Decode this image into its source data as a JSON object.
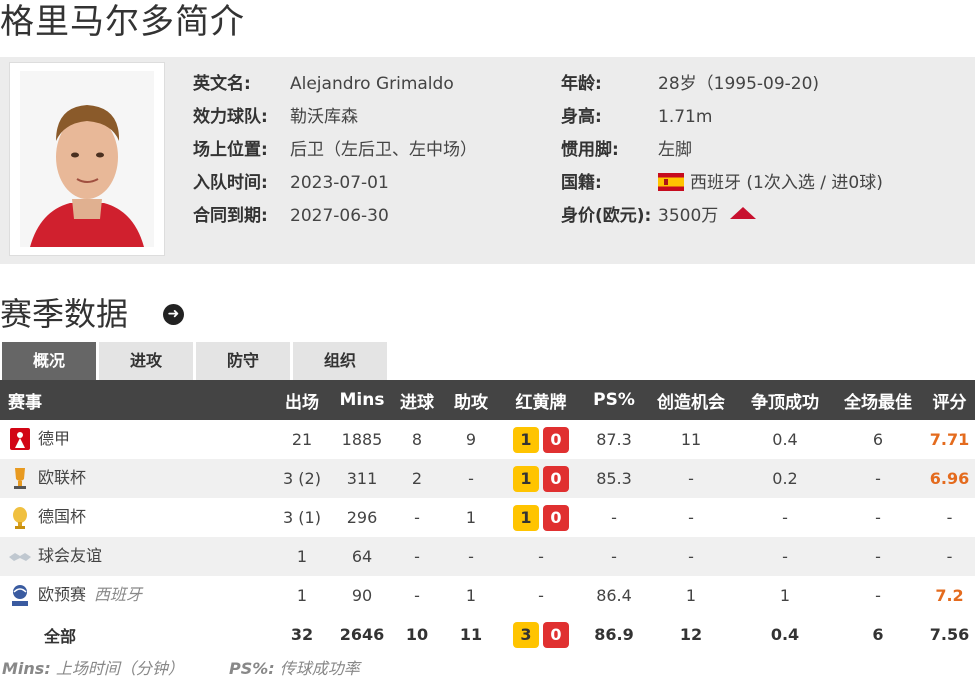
{
  "page_title": "格里马尔多简介",
  "profile": {
    "left": [
      {
        "label": "英文名:",
        "value": "Alejandro Grimaldo"
      },
      {
        "label": "效力球队:",
        "value": "勒沃库森"
      },
      {
        "label": "场上位置:",
        "value": "后卫（左后卫、左中场）"
      },
      {
        "label": "入队时间:",
        "value": "2023-07-01"
      },
      {
        "label": "合同到期:",
        "value": "2027-06-30"
      }
    ],
    "right": [
      {
        "label": "年龄:",
        "value": "28岁（1995-09-20)"
      },
      {
        "label": "身高:",
        "value": "1.71m"
      },
      {
        "label": "惯用脚:",
        "value": "左脚"
      },
      {
        "label": "国籍:",
        "value": "西班牙 (1次入选 / 进0球)"
      },
      {
        "label": "身价(欧元):",
        "value": "3500万"
      }
    ]
  },
  "section_title": "赛季数据",
  "tabs": [
    "概况",
    "进攻",
    "防守",
    "组织"
  ],
  "table": {
    "headers": [
      "赛事",
      "出场",
      "Mins",
      "进球",
      "助攻",
      "红黄牌",
      "PS%",
      "创造机会",
      "争顶成功",
      "全场最佳",
      "评分"
    ],
    "rows": [
      {
        "icon": "bundesliga-icon",
        "comp": "德甲",
        "sub": "",
        "apps": "21",
        "mins": "1885",
        "goals": "8",
        "assists": "9",
        "yellow": "1",
        "red": "0",
        "ps": "87.3",
        "chances": "11",
        "aerial": "0.4",
        "motm": "6",
        "rating": "7.71"
      },
      {
        "icon": "europa-league-icon",
        "comp": "欧联杯",
        "sub": "",
        "apps": "3 (2)",
        "mins": "311",
        "goals": "2",
        "assists": "-",
        "yellow": "1",
        "red": "0",
        "ps": "85.3",
        "chances": "-",
        "aerial": "0.2",
        "motm": "-",
        "rating": "6.96"
      },
      {
        "icon": "dfb-pokal-icon",
        "comp": "德国杯",
        "sub": "",
        "apps": "3 (1)",
        "mins": "296",
        "goals": "-",
        "assists": "1",
        "yellow": "1",
        "red": "0",
        "ps": "-",
        "chances": "-",
        "aerial": "-",
        "motm": "-",
        "rating": "-"
      },
      {
        "icon": "handshake-icon",
        "comp": "球会友谊",
        "sub": "",
        "apps": "1",
        "mins": "64",
        "goals": "-",
        "assists": "-",
        "yellow": "-",
        "red": "",
        "ps": "-",
        "chances": "-",
        "aerial": "-",
        "motm": "-",
        "rating": "-"
      },
      {
        "icon": "euro-qualifiers-icon",
        "comp": "欧预赛",
        "sub": "西班牙",
        "apps": "1",
        "mins": "90",
        "goals": "-",
        "assists": "1",
        "yellow": "-",
        "red": "",
        "ps": "86.4",
        "chances": "1",
        "aerial": "1",
        "motm": "-",
        "rating": "7.2"
      }
    ],
    "total": {
      "comp": "全部",
      "apps": "32",
      "mins": "2646",
      "goals": "10",
      "assists": "11",
      "yellow": "3",
      "red": "0",
      "ps": "86.9",
      "chances": "12",
      "aerial": "0.4",
      "motm": "6",
      "rating": "7.56"
    }
  },
  "footnotes": [
    {
      "key": "Mins:",
      "text": "上场时间（分钟）"
    },
    {
      "key": "PS%:",
      "text": "传球成功率"
    }
  ],
  "colors": {
    "rating": "#e46b1e",
    "header_bg": "#444444",
    "yellow_card": "#ffc400",
    "red_card": "#e03030"
  }
}
